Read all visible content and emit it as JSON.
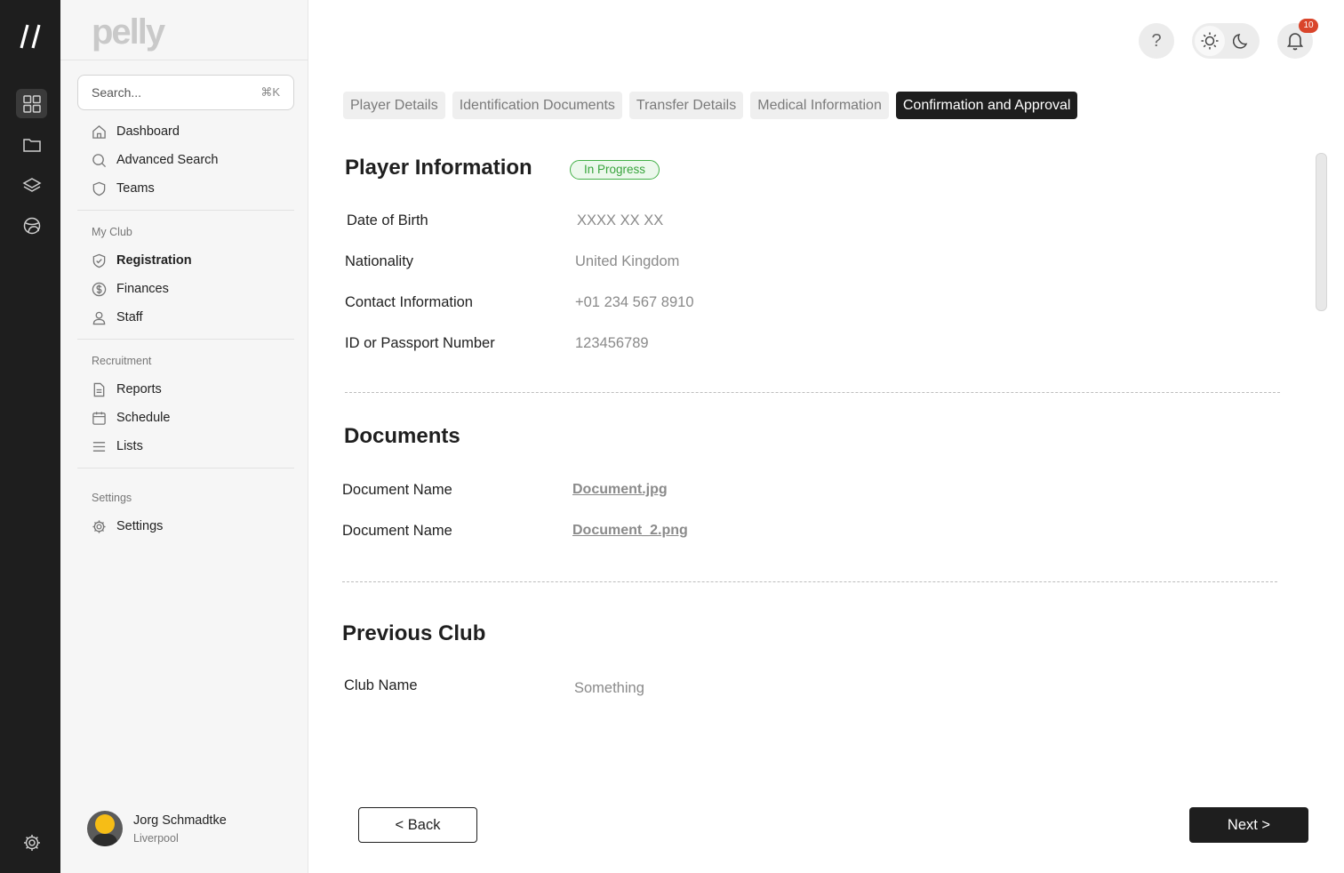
{
  "rail": {
    "items": [
      "grid-icon",
      "folder-icon",
      "layers-icon",
      "globe-icon"
    ],
    "settings_icon": "gear-icon"
  },
  "sidebar": {
    "brand": "pelly",
    "search": {
      "placeholder": "Search...",
      "shortcut": "⌘K"
    },
    "main_items": [
      {
        "label": "Dashboard",
        "icon": "home-icon"
      },
      {
        "label": "Advanced Search",
        "icon": "search-icon"
      },
      {
        "label": "Teams",
        "icon": "shield-icon"
      }
    ],
    "sections": [
      {
        "title": "My Club",
        "items": [
          {
            "label": "Registration",
            "icon": "shield-check-icon",
            "active": true
          },
          {
            "label": "Finances",
            "icon": "dollar-icon"
          },
          {
            "label": "Staff",
            "icon": "user-icon"
          }
        ]
      },
      {
        "title": "Recruitment",
        "items": [
          {
            "label": "Reports",
            "icon": "document-icon"
          },
          {
            "label": "Schedule",
            "icon": "calendar-icon"
          },
          {
            "label": "Lists",
            "icon": "list-icon"
          }
        ]
      },
      {
        "title": "Settings",
        "items": [
          {
            "label": "Settings",
            "icon": "gear-icon"
          }
        ]
      }
    ],
    "user": {
      "name": "Jorg Schmadtke",
      "club": "Liverpool"
    }
  },
  "topbar": {
    "help": "?",
    "notifications": "10"
  },
  "tabs": [
    "Player Details",
    "Identification Documents",
    "Transfer Details",
    "Medical Information",
    "Confirmation and Approval"
  ],
  "active_tab": "Confirmation and Approval",
  "player_info": {
    "title": "Player Information",
    "status": "In Progress",
    "fields": [
      {
        "label": "Date of Birth",
        "value": "XXXX XX XX"
      },
      {
        "label": "Nationality",
        "value": "United Kingdom"
      },
      {
        "label": "Contact Information",
        "value": "+01 234 567 8910"
      },
      {
        "label": "ID or Passport Number",
        "value": "123456789"
      }
    ]
  },
  "documents": {
    "title": "Documents",
    "items": [
      {
        "label": "Document Name",
        "file": "Document.jpg"
      },
      {
        "label": "Document Name",
        "file": "Document_2.png"
      }
    ]
  },
  "previous_club": {
    "title": "Previous Club",
    "fields": [
      {
        "label": "Club Name",
        "value": "Something"
      }
    ]
  },
  "actions": {
    "back": "< Back",
    "next": "Next >"
  },
  "colors": {
    "accent": "#1e1e1e",
    "status": "#38a43c",
    "badge": "#d9452b"
  }
}
